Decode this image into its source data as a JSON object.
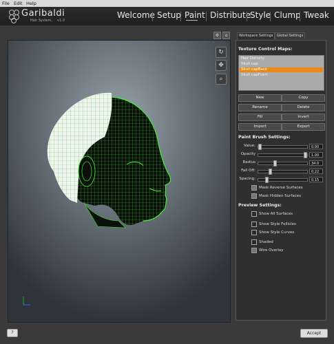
{
  "menu": {
    "items": [
      "File",
      "Edit",
      "Help"
    ]
  },
  "brand": {
    "name": "Garibaldi",
    "subtitle": "Hair System,",
    "version": "v1.0"
  },
  "nav": {
    "tabs": [
      {
        "label": "Welcome"
      },
      {
        "label": "Setup"
      },
      {
        "label": "Paint"
      },
      {
        "label": "Distribute"
      },
      {
        "label": "Style"
      },
      {
        "label": "Clump"
      },
      {
        "label": "Tweak"
      }
    ],
    "active": "Paint"
  },
  "toolbar": {
    "settings_icon": "gear-icon",
    "home_icon": "home-icon"
  },
  "panel_tabs": {
    "workspace": "Workspace Settings",
    "global": "Global Settings"
  },
  "texture": {
    "heading": "Texture Control Maps:",
    "maps": [
      {
        "label": "Hair Density",
        "selected": false
      },
      {
        "label": "Skull cap",
        "selected": false
      },
      {
        "label": "Skull capBack",
        "selected": true
      },
      {
        "label": "Skull capFront",
        "selected": false
      }
    ],
    "buttons": [
      {
        "left": "New",
        "right": "Copy"
      },
      {
        "left": "Rename",
        "right": "Delete"
      },
      {
        "left": "Fill",
        "right": "Invert"
      },
      {
        "left": "Import",
        "right": "Export"
      }
    ]
  },
  "brush": {
    "heading": "Paint Brush Settings:",
    "sliders": [
      {
        "label": "Value:",
        "value": "0.00",
        "fraction": 0.0
      },
      {
        "label": "Opacity",
        "value": "1.00",
        "fraction": 1.0
      },
      {
        "label": "Radius",
        "value": "34.0",
        "fraction": 0.34
      },
      {
        "label": "Fall Off:",
        "value": "0.22",
        "fraction": 0.22
      },
      {
        "label": "Spacing:",
        "value": "0.15",
        "fraction": 0.15
      }
    ],
    "checks": [
      {
        "label": "Mask Reverse Surfaces",
        "checked": true
      },
      {
        "label": "Mask Hidden Surfaces",
        "checked": true
      }
    ]
  },
  "preview": {
    "heading": "Preview Settings:",
    "checks": [
      {
        "label": "Show All Surfaces",
        "checked": false
      },
      {
        "label": "Show Style Follicles",
        "checked": false
      },
      {
        "label": "Show Style Curves",
        "checked": false
      },
      {
        "label": "Shaded",
        "checked": false
      },
      {
        "label": "Wire Overlay",
        "checked": true
      }
    ]
  },
  "viewport_tools": [
    "rotate-icon",
    "move-icon",
    "zoom-icon"
  ],
  "footer": {
    "help_label": "?",
    "accept_label": "Accept"
  },
  "colors": {
    "accent": "#ea8a12",
    "wire": "#33dd22"
  }
}
